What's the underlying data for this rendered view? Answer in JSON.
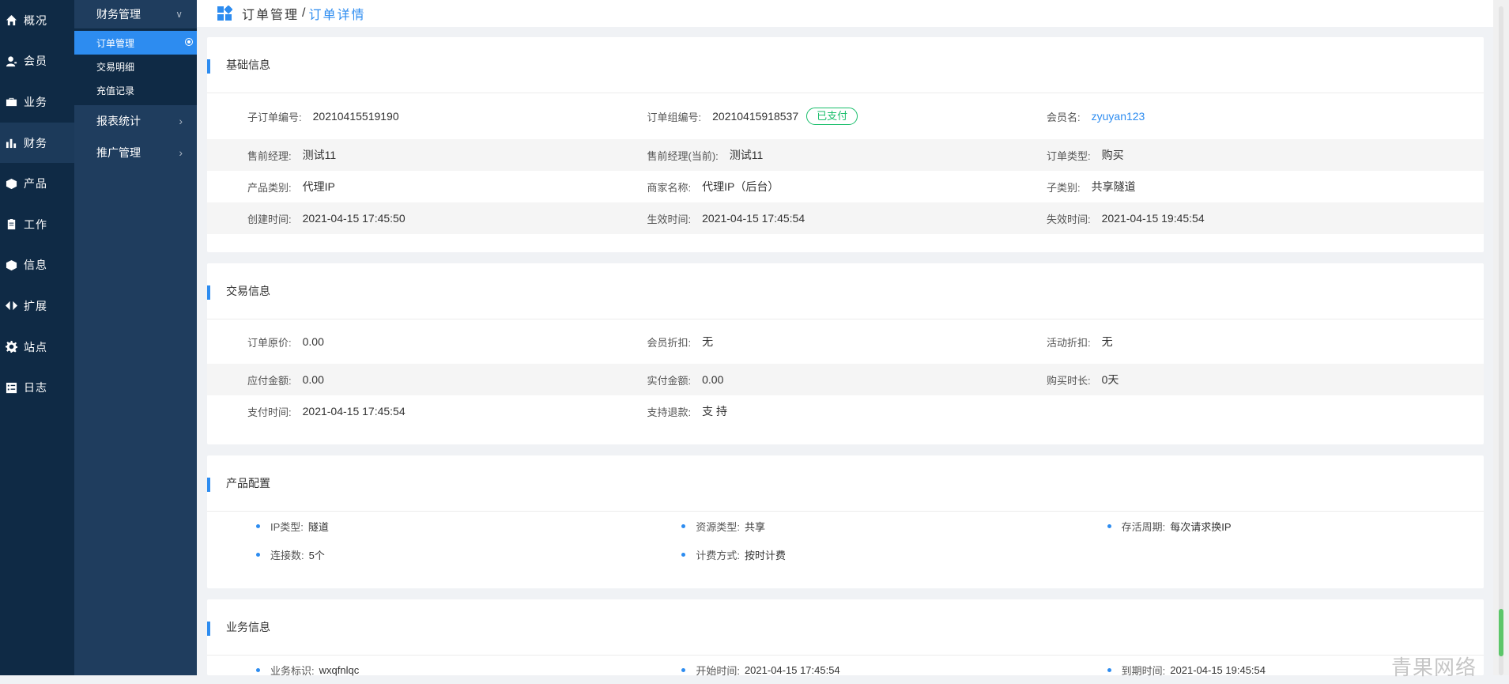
{
  "primary_nav": [
    {
      "label": "概况",
      "icon": "home-icon"
    },
    {
      "label": "会员",
      "icon": "user-icon"
    },
    {
      "label": "业务",
      "icon": "briefcase-icon"
    },
    {
      "label": "财务",
      "icon": "bar-chart-icon",
      "active": true
    },
    {
      "label": "产品",
      "icon": "cube-icon"
    },
    {
      "label": "工作",
      "icon": "clipboard-icon"
    },
    {
      "label": "信息",
      "icon": "box-icon"
    },
    {
      "label": "扩展",
      "icon": "code-icon"
    },
    {
      "label": "站点",
      "icon": "gear-icon"
    },
    {
      "label": "日志",
      "icon": "list-icon"
    }
  ],
  "secondary_nav": {
    "group_label": "财务管理",
    "items": [
      {
        "label": "订单管理",
        "active": true
      },
      {
        "label": "交易明细"
      },
      {
        "label": "充值记录"
      }
    ],
    "groups": [
      {
        "label": "报表统计"
      },
      {
        "label": "推广管理"
      }
    ]
  },
  "header": {
    "breadcrumb_parent": "订单管理",
    "separator": "/",
    "breadcrumb_current": "订单详情"
  },
  "basic": {
    "title": "基础信息",
    "rows": [
      [
        {
          "k": "子订单编号:",
          "v": "20210415519190"
        },
        {
          "k": "订单组编号:",
          "v": "20210415918537",
          "badge": "已支付"
        },
        {
          "k": "会员名:",
          "v": "zyuyan123",
          "link": true
        }
      ],
      [
        {
          "k": "售前经理:",
          "v": "测试11"
        },
        {
          "k": "售前经理(当前):",
          "v": "测试11"
        },
        {
          "k": "订单类型:",
          "v": "购买"
        }
      ],
      [
        {
          "k": "产品类别:",
          "v": "代理IP"
        },
        {
          "k": "商家名称:",
          "v": "代理IP（后台）"
        },
        {
          "k": "子类别:",
          "v": "共享隧道"
        }
      ],
      [
        {
          "k": "创建时间:",
          "v": "2021-04-15 17:45:50"
        },
        {
          "k": "生效时间:",
          "v": "2021-04-15 17:45:54"
        },
        {
          "k": "失效时间:",
          "v": "2021-04-15 19:45:54"
        }
      ]
    ]
  },
  "trade": {
    "title": "交易信息",
    "rows": [
      [
        {
          "k": "订单原价:",
          "v": "0.00"
        },
        {
          "k": "会员折扣:",
          "v": "无"
        },
        {
          "k": "活动折扣:",
          "v": "无"
        }
      ],
      [
        {
          "k": "应付金额:",
          "v": "0.00"
        },
        {
          "k": "实付金额:",
          "v": "0.00"
        },
        {
          "k": "购买时长:",
          "v": "0天"
        }
      ],
      [
        {
          "k": "支付时间:",
          "v": "2021-04-15 17:45:54"
        },
        {
          "k": "支持退款:",
          "v": "支 持"
        },
        {
          "k": "",
          "v": ""
        }
      ]
    ]
  },
  "product": {
    "title": "产品配置",
    "rows": [
      [
        {
          "k": "IP类型:",
          "v": "隧道"
        },
        {
          "k": "资源类型:",
          "v": "共享"
        },
        {
          "k": "存活周期:",
          "v": "每次请求换IP"
        }
      ],
      [
        {
          "k": "连接数:",
          "v": "5个"
        },
        {
          "k": "计费方式:",
          "v": "按时计费"
        }
      ]
    ]
  },
  "business": {
    "title": "业务信息",
    "rows": [
      [
        {
          "k": "业务标识:",
          "v": "wxqfnlqc"
        },
        {
          "k": "开始时间:",
          "v": "2021-04-15 17:45:54"
        },
        {
          "k": "到期时间:",
          "v": "2021-04-15 19:45:54"
        }
      ]
    ]
  },
  "watermark": "青果网络",
  "colors": {
    "accent": "#2d8cf0",
    "sidebar": "#0f2a45",
    "success": "#19be6b"
  }
}
